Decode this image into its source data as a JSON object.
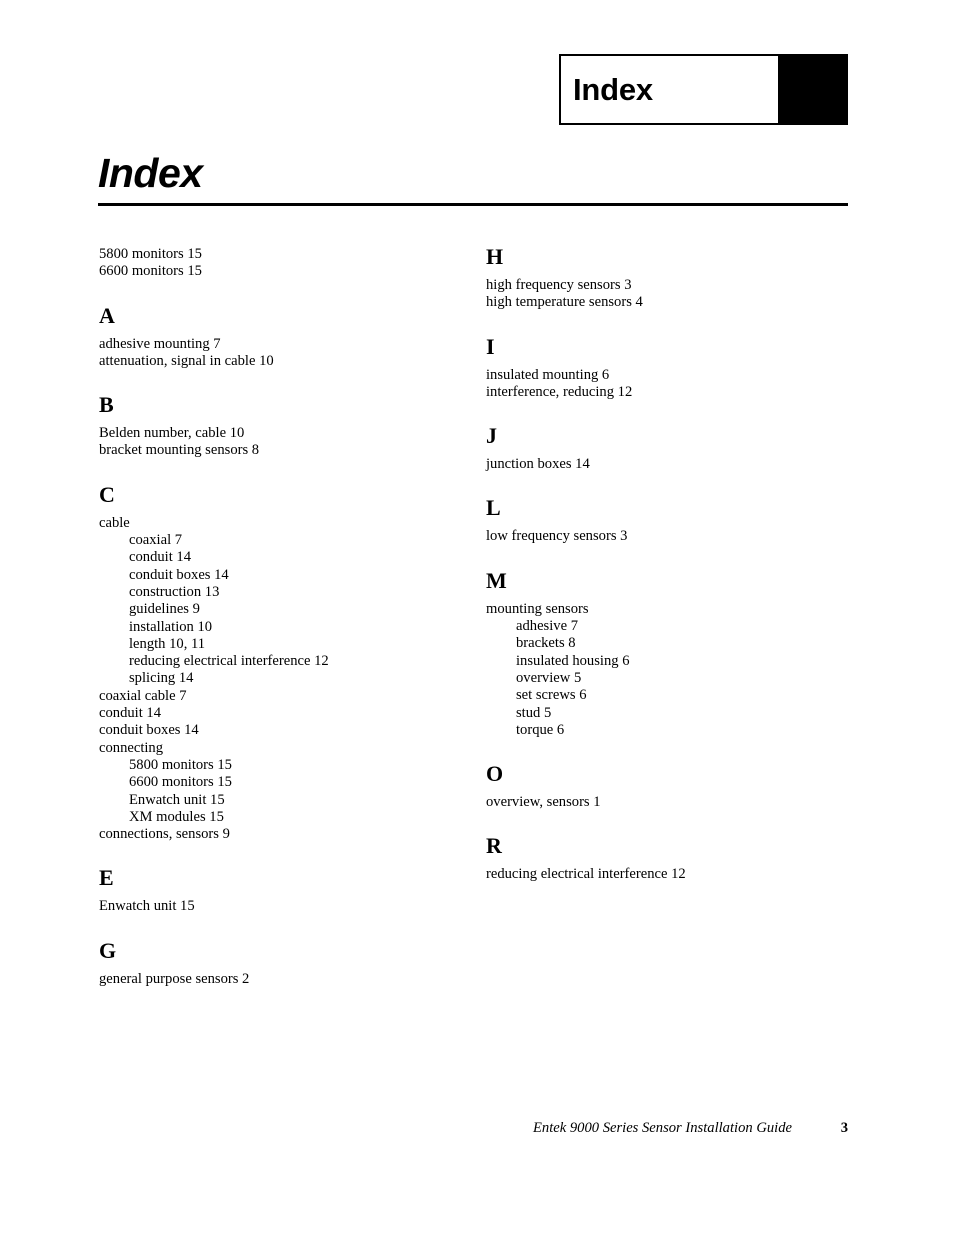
{
  "running_header": {
    "label": "Index"
  },
  "chapter": {
    "title": "Index"
  },
  "footer": {
    "document_title": "Entek 9000 Series Sensor Installation Guide",
    "page_number": "3"
  },
  "index": {
    "columns": [
      {
        "name": "left-column",
        "sections": [
          {
            "letter": "",
            "entries": [
              {
                "text": "5800 monitors 15",
                "level": 0
              },
              {
                "text": "6600 monitors 15",
                "level": 0
              }
            ]
          },
          {
            "letter": "A",
            "entries": [
              {
                "text": "adhesive mounting 7",
                "level": 0
              },
              {
                "text": "attenuation, signal in cable 10",
                "level": 0
              }
            ]
          },
          {
            "letter": "B",
            "entries": [
              {
                "text": "Belden number, cable 10",
                "level": 0
              },
              {
                "text": "bracket mounting sensors 8",
                "level": 0
              }
            ]
          },
          {
            "letter": "C",
            "entries": [
              {
                "text": "cable",
                "level": 0
              },
              {
                "text": "coaxial 7",
                "level": 1
              },
              {
                "text": "conduit 14",
                "level": 1
              },
              {
                "text": "conduit boxes 14",
                "level": 1
              },
              {
                "text": "construction 13",
                "level": 1
              },
              {
                "text": "guidelines 9",
                "level": 1
              },
              {
                "text": "installation 10",
                "level": 1
              },
              {
                "text": "length 10, 11",
                "level": 1
              },
              {
                "text": "reducing electrical interference 12",
                "level": 1
              },
              {
                "text": "splicing 14",
                "level": 1
              },
              {
                "text": "coaxial cable 7",
                "level": 0
              },
              {
                "text": "conduit 14",
                "level": 0
              },
              {
                "text": "conduit boxes 14",
                "level": 0
              },
              {
                "text": "connecting",
                "level": 0
              },
              {
                "text": "5800 monitors 15",
                "level": 1
              },
              {
                "text": "6600 monitors 15",
                "level": 1
              },
              {
                "text": "Enwatch unit 15",
                "level": 1
              },
              {
                "text": "XM modules 15",
                "level": 1
              },
              {
                "text": "connections, sensors 9",
                "level": 0
              }
            ]
          },
          {
            "letter": "E",
            "entries": [
              {
                "text": "Enwatch unit 15",
                "level": 0
              }
            ]
          },
          {
            "letter": "G",
            "entries": [
              {
                "text": "general purpose sensors 2",
                "level": 0
              }
            ]
          }
        ]
      },
      {
        "name": "right-column",
        "sections": [
          {
            "letter": "H",
            "entries": [
              {
                "text": "high frequency sensors 3",
                "level": 0
              },
              {
                "text": "high temperature sensors 4",
                "level": 0
              }
            ]
          },
          {
            "letter": "I",
            "entries": [
              {
                "text": "insulated mounting 6",
                "level": 0
              },
              {
                "text": "interference, reducing 12",
                "level": 0
              }
            ]
          },
          {
            "letter": "J",
            "entries": [
              {
                "text": "junction boxes 14",
                "level": 0
              }
            ]
          },
          {
            "letter": "L",
            "entries": [
              {
                "text": "low frequency sensors 3",
                "level": 0
              }
            ]
          },
          {
            "letter": "M",
            "entries": [
              {
                "text": "mounting sensors",
                "level": 0
              },
              {
                "text": "adhesive 7",
                "level": 1
              },
              {
                "text": "brackets 8",
                "level": 1
              },
              {
                "text": "insulated housing 6",
                "level": 1
              },
              {
                "text": "overview 5",
                "level": 1
              },
              {
                "text": "set screws 6",
                "level": 1
              },
              {
                "text": "stud 5",
                "level": 1
              },
              {
                "text": "torque 6",
                "level": 1
              }
            ]
          },
          {
            "letter": "O",
            "entries": [
              {
                "text": "overview, sensors 1",
                "level": 0
              }
            ]
          },
          {
            "letter": "R",
            "entries": [
              {
                "text": "reducing electrical interference 12",
                "level": 0
              }
            ]
          }
        ]
      }
    ]
  }
}
